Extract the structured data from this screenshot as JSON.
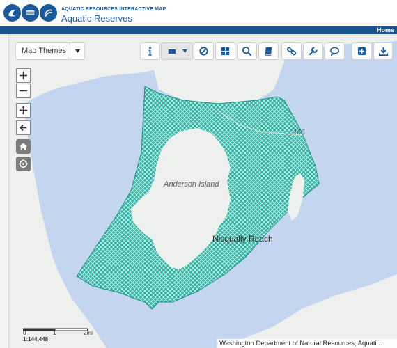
{
  "header": {
    "super_title": "AQUATIC RESOURCES INTERACTIVE MAP",
    "title": "Aquatic Reserves"
  },
  "nav": {
    "home": "Home"
  },
  "toolbar": {
    "themes_label": "Map Themes",
    "icons": [
      "info-icon",
      "rectangle-select-icon",
      "clear-selection-icon",
      "layers-grid-icon",
      "search-icon",
      "bookmark-icon",
      "link-icon",
      "tools-wrench-icon",
      "comment-icon",
      "add-icon",
      "download-icon"
    ]
  },
  "map": {
    "labels": {
      "island": "Anderson Island",
      "reach": "Nisqually Reach",
      "route": "166"
    },
    "colors": {
      "water": "#c4d6ef",
      "land": "#eef0ed",
      "reserve": "#1fa698"
    }
  },
  "scalebar": {
    "ticks": [
      "0",
      "1",
      "2mi"
    ],
    "scale": "1:144,448"
  },
  "attribution": "Washington Department of Natural Resources, Aquati..."
}
